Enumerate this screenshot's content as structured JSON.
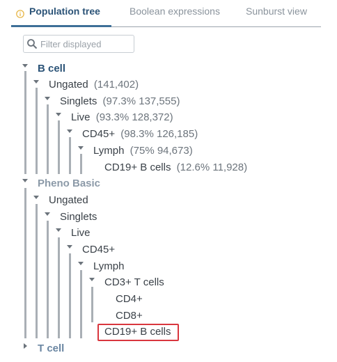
{
  "tabs": [
    {
      "label": "Population tree"
    },
    {
      "label": "Boolean expressions"
    },
    {
      "label": "Sunburst view"
    }
  ],
  "filter": {
    "placeholder": "Filter displayed"
  },
  "tree": {
    "bcell": {
      "name": "B cell",
      "ungated": {
        "label": "Ungated",
        "stat": "(141,402)"
      },
      "singlets": {
        "label": "Singlets",
        "stat": "(97.3%  137,555)"
      },
      "live": {
        "label": "Live",
        "stat": "(93.3%  128,372)"
      },
      "cd45": {
        "label": "CD45+",
        "stat": "(98.3%  126,185)"
      },
      "lymph": {
        "label": "Lymph",
        "stat": "(75%  94,673)"
      },
      "cd19": {
        "label": "CD19+ B cells",
        "stat": "(12.6%  11,928)"
      }
    },
    "pheno": {
      "name": "Pheno Basic",
      "ungated": {
        "label": "Ungated"
      },
      "singlets": {
        "label": "Singlets"
      },
      "live": {
        "label": "Live"
      },
      "cd45": {
        "label": "CD45+"
      },
      "lymph": {
        "label": "Lymph"
      },
      "cd3": {
        "label": "CD3+ T cells"
      },
      "cd4": {
        "label": "CD4+"
      },
      "cd8": {
        "label": "CD8+"
      },
      "cd19": {
        "label": "CD19+ B cells"
      }
    },
    "tcell": {
      "name": "T cell"
    }
  },
  "colors": {
    "accent": "#2b5377",
    "highlight": "#d9363e",
    "info": "#e6b23c"
  }
}
